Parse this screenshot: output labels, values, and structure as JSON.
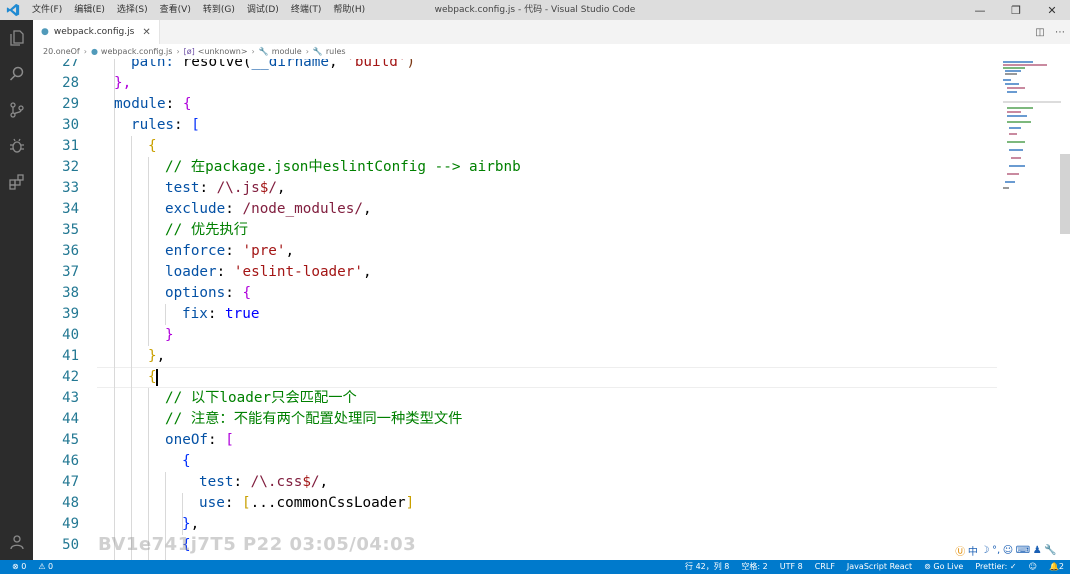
{
  "window": {
    "title": "webpack.config.js - 代码 - Visual Studio Code",
    "minimize": "—",
    "maximize": "❐",
    "close": "✕"
  },
  "menu": [
    "文件(F)",
    "编辑(E)",
    "选择(S)",
    "查看(V)",
    "转到(G)",
    "调试(D)",
    "终端(T)",
    "帮助(H)"
  ],
  "activity": [
    "files-icon",
    "search-icon",
    "source-control-icon",
    "debug-icon",
    "extensions-icon",
    "account-icon"
  ],
  "tabs": [
    {
      "label": "webpack.config.js",
      "close": "✕"
    }
  ],
  "breadcrumb": {
    "items": [
      "20.oneOf",
      "webpack.config.js",
      "<unknown>",
      "module",
      "rules"
    ]
  },
  "line_numbers": [
    "27",
    "28",
    "29",
    "30",
    "31",
    "32",
    "33",
    "34",
    "35",
    "36",
    "37",
    "38",
    "39",
    "40",
    "41",
    "42",
    "43",
    "44",
    "45",
    "46",
    "47",
    "48",
    "49",
    "50"
  ],
  "code": {
    "l27": {
      "a": "path: ",
      "b": "resolve(",
      "c": "__dirname",
      "d": ", ",
      "e": "'build'",
      "f": ")"
    },
    "l28": {
      "a": "},"
    },
    "l29": {
      "a": "module",
      "b": ": ",
      "c": "{"
    },
    "l30": {
      "a": "rules",
      "b": ": ",
      "c": "["
    },
    "l31": {
      "a": "{"
    },
    "l32": {
      "a": "// 在package.json中eslintConfig --> airbnb"
    },
    "l33": {
      "a": "test",
      "b": ": ",
      "c": "/\\.js",
      "d": "$",
      "e": "/",
      "f": ","
    },
    "l34": {
      "a": "exclude",
      "b": ": ",
      "c": "/node_modules/",
      "d": ","
    },
    "l35": {
      "a": "// 优先执行"
    },
    "l36": {
      "a": "enforce",
      "b": ": ",
      "c": "'pre'",
      "d": ","
    },
    "l37": {
      "a": "loader",
      "b": ": ",
      "c": "'eslint-loader'",
      "d": ","
    },
    "l38": {
      "a": "options",
      "b": ": ",
      "c": "{"
    },
    "l39": {
      "a": "fix",
      "b": ": ",
      "c": "true"
    },
    "l40": {
      "a": "}"
    },
    "l41": {
      "a": "}",
      "b": ","
    },
    "l42": {
      "a": "{"
    },
    "l43": {
      "a": "// 以下loader只会匹配一个"
    },
    "l44": {
      "a": "// 注意：不能有两个配置处理同一种类型文件"
    },
    "l45": {
      "a": "oneOf",
      "b": ": ",
      "c": "["
    },
    "l46": {
      "a": "{"
    },
    "l47": {
      "a": "test",
      "b": ": ",
      "c": "/\\.css",
      "d": "$",
      "e": "/",
      "f": ","
    },
    "l48": {
      "a": "use",
      "b": ": ",
      "c": "[",
      "d": "...commonCssLoader",
      "e": "]"
    },
    "l49": {
      "a": "}",
      "b": ","
    },
    "l50": {
      "a": "{"
    }
  },
  "watermark": "BV1e741j7T5 P22 03:05/04:03",
  "ime": [
    "中",
    "☽",
    "°,",
    "☺",
    "⌨",
    "♟",
    "🔧"
  ],
  "status": {
    "errors": "⊗ 0",
    "warnings": "⚠ 0",
    "position": "行 42，列 8",
    "spaces": "空格: 2",
    "encoding": "UTF 8",
    "eol": "CRLF",
    "language": "JavaScript React",
    "golive": "Go Live",
    "prettier": "Prettier: ✓",
    "notifications": "2"
  },
  "colors": {
    "activitybar": "#2c2c2c",
    "statusbar": "#007acc",
    "line_number": "#237893",
    "comment": "#008000",
    "property": "#0451a5",
    "string": "#a31515"
  }
}
